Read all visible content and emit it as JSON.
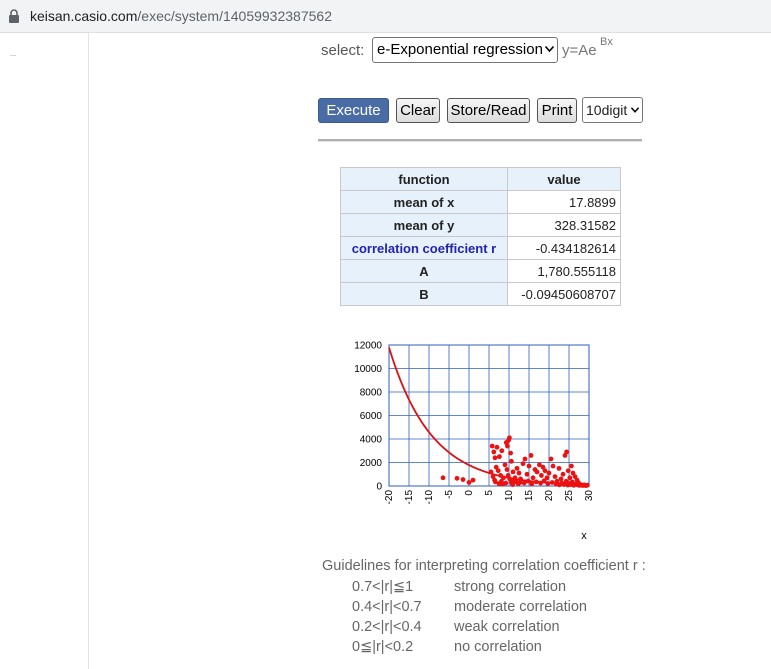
{
  "browser": {
    "url_domain": "keisan.casio.com",
    "url_path": "/exec/system/14059932387562"
  },
  "form": {
    "select_label": "select:",
    "regression_type": "e-Exponential regression",
    "formula_base": "y=Ae",
    "formula_exp": "Bx",
    "buttons": {
      "execute": "Execute",
      "clear": "Clear",
      "store_read": "Store/Read",
      "print": "Print"
    },
    "digits": "10digit"
  },
  "results": {
    "headers": [
      "function",
      "value"
    ],
    "rows": [
      {
        "function": "mean of x",
        "value": "17.8899"
      },
      {
        "function": "mean of y",
        "value": "328.31582"
      },
      {
        "function": "correlation coefficient r",
        "value": "-0.434182614"
      },
      {
        "function": "A",
        "value": "1,780.555118"
      },
      {
        "function": "B",
        "value": "-0.09450608707"
      }
    ]
  },
  "chart_data": {
    "type": "scatter",
    "xlabel": "x",
    "ylabel": "",
    "xlim": [
      -20,
      30
    ],
    "ylim": [
      0,
      12000
    ],
    "x_ticks": [
      -20,
      -15,
      -10,
      -5,
      0,
      5,
      10,
      15,
      20,
      25,
      30
    ],
    "y_ticks": [
      0,
      2000,
      4000,
      6000,
      8000,
      10000,
      12000
    ],
    "grid": true,
    "colors": {
      "points": "#ee1111",
      "curve": "#dd1111",
      "grid": "#2f5fbf"
    },
    "curve": {
      "name": "y=Ae^Bx",
      "A": 1780.555118,
      "B": -0.09450608707
    },
    "points": [
      [
        -6.5,
        700
      ],
      [
        -3,
        650
      ],
      [
        -1.5,
        550
      ],
      [
        0,
        300
      ],
      [
        1,
        500
      ],
      [
        5.8,
        3400
      ],
      [
        6.2,
        2900
      ],
      [
        6.5,
        2400
      ],
      [
        7,
        3300
      ],
      [
        7.6,
        2500
      ],
      [
        8.2,
        3000
      ],
      [
        5.5,
        1200
      ],
      [
        6,
        800
      ],
      [
        6.4,
        500
      ],
      [
        6.8,
        1600
      ],
      [
        7.3,
        1300
      ],
      [
        7.9,
        900
      ],
      [
        8.1,
        400
      ],
      [
        8.6,
        700
      ],
      [
        9,
        1800
      ],
      [
        9.3,
        3700
      ],
      [
        9.6,
        3400
      ],
      [
        9.9,
        3900
      ],
      [
        10.1,
        4100
      ],
      [
        10.4,
        2800
      ],
      [
        10.6,
        2100
      ],
      [
        9.5,
        1400
      ],
      [
        9.8,
        900
      ],
      [
        10.2,
        600
      ],
      [
        10.6,
        300
      ],
      [
        11,
        1200
      ],
      [
        11.5,
        700
      ],
      [
        12,
        1500
      ],
      [
        12.5,
        1100
      ],
      [
        11.2,
        400
      ],
      [
        12.3,
        200
      ],
      [
        12.8,
        300
      ],
      [
        13.5,
        1900
      ],
      [
        14,
        2300
      ],
      [
        14.5,
        1000
      ],
      [
        15,
        1700
      ],
      [
        15.5,
        2600
      ],
      [
        16,
        700
      ],
      [
        16.5,
        1400
      ],
      [
        17,
        1200
      ],
      [
        17.6,
        1800
      ],
      [
        18.1,
        900
      ],
      [
        18.5,
        1600
      ],
      [
        19,
        1300
      ],
      [
        19.5,
        700
      ],
      [
        20,
        1100
      ],
      [
        20.5,
        2300
      ],
      [
        21,
        1700
      ],
      [
        21.5,
        800
      ],
      [
        22,
        400
      ],
      [
        22.5,
        1500
      ],
      [
        23,
        600
      ],
      [
        23.5,
        1000
      ],
      [
        24,
        2600
      ],
      [
        24.4,
        2900
      ],
      [
        24.8,
        1300
      ],
      [
        25.2,
        700
      ],
      [
        25.6,
        1700
      ],
      [
        26,
        1100
      ],
      [
        26.5,
        800
      ],
      [
        27,
        500
      ],
      [
        27.3,
        300
      ],
      [
        21.8,
        150
      ],
      [
        22.6,
        100
      ],
      [
        23.2,
        250
      ],
      [
        23.8,
        120
      ],
      [
        24.3,
        400
      ],
      [
        24.7,
        80
      ],
      [
        25.1,
        200
      ],
      [
        25.4,
        120
      ],
      [
        25.8,
        350
      ],
      [
        26.2,
        60
      ],
      [
        26.6,
        150
      ],
      [
        27.1,
        100
      ],
      [
        27.6,
        50
      ],
      [
        28,
        120
      ],
      [
        28.4,
        40
      ],
      [
        28.8,
        90
      ],
      [
        29.2,
        30
      ],
      [
        29.6,
        70
      ],
      [
        20.8,
        300
      ],
      [
        19.7,
        200
      ],
      [
        18.8,
        450
      ],
      [
        17.9,
        250
      ],
      [
        16.8,
        350
      ],
      [
        15.7,
        180
      ],
      [
        14.8,
        420
      ],
      [
        13.8,
        260
      ],
      [
        12.9,
        600
      ],
      [
        11.8,
        350
      ],
      [
        10.9,
        120
      ],
      [
        9.2,
        250
      ],
      [
        8.4,
        150
      ],
      [
        7.5,
        200
      ],
      [
        6.6,
        350
      ]
    ]
  },
  "guidelines": {
    "title": "Guidelines for interpreting correlation coefficient r :",
    "rows": [
      {
        "range": "0.7<|r|≦1",
        "label": "strong correlation"
      },
      {
        "range": "0.4<|r|<0.7",
        "label": "moderate correlation"
      },
      {
        "range": "0.2<|r|<0.4",
        "label": "weak correlation"
      },
      {
        "range": "0≦|r|<0.2",
        "label": " no correlation"
      }
    ]
  }
}
